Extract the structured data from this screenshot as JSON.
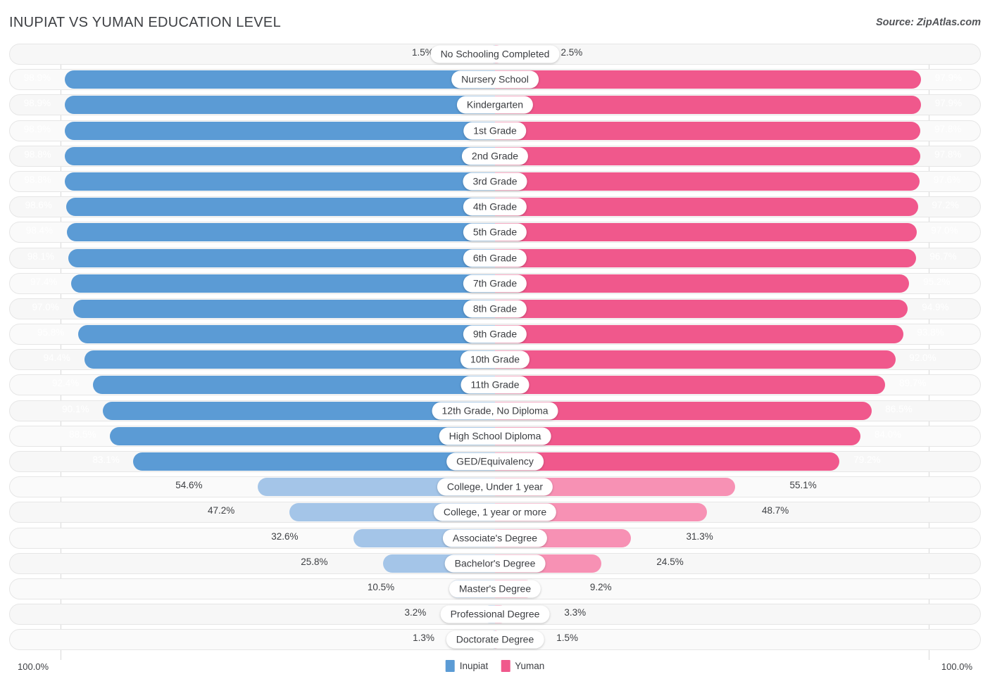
{
  "header": {
    "title": "INUPIAT VS YUMAN EDUCATION LEVEL",
    "source": "Source: ZipAtlas.com"
  },
  "legend": {
    "items": [
      {
        "label": "Inupiat",
        "color": "#5b9bd5"
      },
      {
        "label": "Yuman",
        "color": "#f0588c"
      }
    ]
  },
  "axis": {
    "left_end": "100.0%",
    "right_end": "100.0%"
  },
  "colors": {
    "blue_dark": "#5b9bd5",
    "blue_light": "#a4c5e8",
    "pink_dark": "#f0588c",
    "pink_light": "#f791b4",
    "track": "#f7f7f7",
    "track_border": "#e6e6e6",
    "text": "#3e4044"
  },
  "chart_data": {
    "type": "bar",
    "orientation": "horizontal-diverging",
    "title": "INUPIAT VS YUMAN EDUCATION LEVEL",
    "xlabel": "",
    "ylabel": "",
    "xlim": [
      0,
      100
    ],
    "grid": false,
    "legend_position": "bottom-center",
    "series": [
      {
        "name": "Inupiat",
        "color": "#5b9bd5",
        "side": "left"
      },
      {
        "name": "Yuman",
        "color": "#f0588c",
        "side": "right"
      }
    ],
    "categories": [
      "No Schooling Completed",
      "Nursery School",
      "Kindergarten",
      "1st Grade",
      "2nd Grade",
      "3rd Grade",
      "4th Grade",
      "5th Grade",
      "6th Grade",
      "7th Grade",
      "8th Grade",
      "9th Grade",
      "10th Grade",
      "11th Grade",
      "12th Grade, No Diploma",
      "High School Diploma",
      "GED/Equivalency",
      "College, Under 1 year",
      "College, 1 year or more",
      "Associate's Degree",
      "Bachelor's Degree",
      "Master's Degree",
      "Professional Degree",
      "Doctorate Degree"
    ],
    "rows": [
      {
        "label": "No Schooling Completed",
        "left_value": 1.5,
        "left_text": "1.5%",
        "right_value": 2.5,
        "right_text": "2.5%",
        "left_inside": false,
        "right_inside": false,
        "left_shade": "light",
        "right_shade": "light"
      },
      {
        "label": "Nursery School",
        "left_value": 98.9,
        "left_text": "98.9%",
        "right_value": 97.9,
        "right_text": "97.9%",
        "left_inside": true,
        "right_inside": true,
        "left_shade": "dark",
        "right_shade": "dark"
      },
      {
        "label": "Kindergarten",
        "left_value": 98.9,
        "left_text": "98.9%",
        "right_value": 97.9,
        "right_text": "97.9%",
        "left_inside": true,
        "right_inside": true,
        "left_shade": "dark",
        "right_shade": "dark"
      },
      {
        "label": "1st Grade",
        "left_value": 98.9,
        "left_text": "98.9%",
        "right_value": 97.8,
        "right_text": "97.8%",
        "left_inside": true,
        "right_inside": true,
        "left_shade": "dark",
        "right_shade": "dark"
      },
      {
        "label": "2nd Grade",
        "left_value": 98.8,
        "left_text": "98.8%",
        "right_value": 97.8,
        "right_text": "97.8%",
        "left_inside": true,
        "right_inside": true,
        "left_shade": "dark",
        "right_shade": "dark"
      },
      {
        "label": "3rd Grade",
        "left_value": 98.8,
        "left_text": "98.8%",
        "right_value": 97.6,
        "right_text": "97.6%",
        "left_inside": true,
        "right_inside": true,
        "left_shade": "dark",
        "right_shade": "dark"
      },
      {
        "label": "4th Grade",
        "left_value": 98.6,
        "left_text": "98.6%",
        "right_value": 97.2,
        "right_text": "97.2%",
        "left_inside": true,
        "right_inside": true,
        "left_shade": "dark",
        "right_shade": "dark"
      },
      {
        "label": "5th Grade",
        "left_value": 98.4,
        "left_text": "98.4%",
        "right_value": 97.0,
        "right_text": "97.0%",
        "left_inside": true,
        "right_inside": true,
        "left_shade": "dark",
        "right_shade": "dark"
      },
      {
        "label": "6th Grade",
        "left_value": 98.1,
        "left_text": "98.1%",
        "right_value": 96.7,
        "right_text": "96.7%",
        "left_inside": true,
        "right_inside": true,
        "left_shade": "dark",
        "right_shade": "dark"
      },
      {
        "label": "7th Grade",
        "left_value": 97.4,
        "left_text": "97.4%",
        "right_value": 95.2,
        "right_text": "95.2%",
        "left_inside": true,
        "right_inside": true,
        "left_shade": "dark",
        "right_shade": "dark"
      },
      {
        "label": "8th Grade",
        "left_value": 97.0,
        "left_text": "97.0%",
        "right_value": 94.9,
        "right_text": "94.9%",
        "left_inside": true,
        "right_inside": true,
        "left_shade": "dark",
        "right_shade": "dark"
      },
      {
        "label": "9th Grade",
        "left_value": 95.8,
        "left_text": "95.8%",
        "right_value": 93.8,
        "right_text": "93.8%",
        "left_inside": true,
        "right_inside": true,
        "left_shade": "dark",
        "right_shade": "dark"
      },
      {
        "label": "10th Grade",
        "left_value": 94.4,
        "left_text": "94.4%",
        "right_value": 92.0,
        "right_text": "92.0%",
        "left_inside": true,
        "right_inside": true,
        "left_shade": "dark",
        "right_shade": "dark"
      },
      {
        "label": "11th Grade",
        "left_value": 92.4,
        "left_text": "92.4%",
        "right_value": 89.7,
        "right_text": "89.7%",
        "left_inside": true,
        "right_inside": true,
        "left_shade": "dark",
        "right_shade": "dark"
      },
      {
        "label": "12th Grade, No Diploma",
        "left_value": 90.1,
        "left_text": "90.1%",
        "right_value": 86.5,
        "right_text": "86.5%",
        "left_inside": true,
        "right_inside": true,
        "left_shade": "dark",
        "right_shade": "dark"
      },
      {
        "label": "High School Diploma",
        "left_value": 88.5,
        "left_text": "88.5%",
        "right_value": 84.0,
        "right_text": "84.0%",
        "left_inside": true,
        "right_inside": true,
        "left_shade": "dark",
        "right_shade": "dark"
      },
      {
        "label": "GED/Equivalency",
        "left_value": 83.1,
        "left_text": "83.1%",
        "right_value": 79.2,
        "right_text": "79.2%",
        "left_inside": true,
        "right_inside": true,
        "left_shade": "dark",
        "right_shade": "dark"
      },
      {
        "label": "College, Under 1 year",
        "left_value": 54.6,
        "left_text": "54.6%",
        "right_value": 55.1,
        "right_text": "55.1%",
        "left_inside": false,
        "right_inside": false,
        "left_shade": "light",
        "right_shade": "light"
      },
      {
        "label": "College, 1 year or more",
        "left_value": 47.2,
        "left_text": "47.2%",
        "right_value": 48.7,
        "right_text": "48.7%",
        "left_inside": false,
        "right_inside": false,
        "left_shade": "light",
        "right_shade": "light"
      },
      {
        "label": "Associate's Degree",
        "left_value": 32.6,
        "left_text": "32.6%",
        "right_value": 31.3,
        "right_text": "31.3%",
        "left_inside": false,
        "right_inside": false,
        "left_shade": "light",
        "right_shade": "light"
      },
      {
        "label": "Bachelor's Degree",
        "left_value": 25.8,
        "left_text": "25.8%",
        "right_value": 24.5,
        "right_text": "24.5%",
        "left_inside": false,
        "right_inside": false,
        "left_shade": "light",
        "right_shade": "light"
      },
      {
        "label": "Master's Degree",
        "left_value": 10.5,
        "left_text": "10.5%",
        "right_value": 9.2,
        "right_text": "9.2%",
        "left_inside": false,
        "right_inside": false,
        "left_shade": "light",
        "right_shade": "light"
      },
      {
        "label": "Professional Degree",
        "left_value": 3.2,
        "left_text": "3.2%",
        "right_value": 3.3,
        "right_text": "3.3%",
        "left_inside": false,
        "right_inside": false,
        "left_shade": "light",
        "right_shade": "light"
      },
      {
        "label": "Doctorate Degree",
        "left_value": 1.3,
        "left_text": "1.3%",
        "right_value": 1.5,
        "right_text": "1.5%",
        "left_inside": false,
        "right_inside": false,
        "left_shade": "light",
        "right_shade": "light"
      }
    ]
  }
}
